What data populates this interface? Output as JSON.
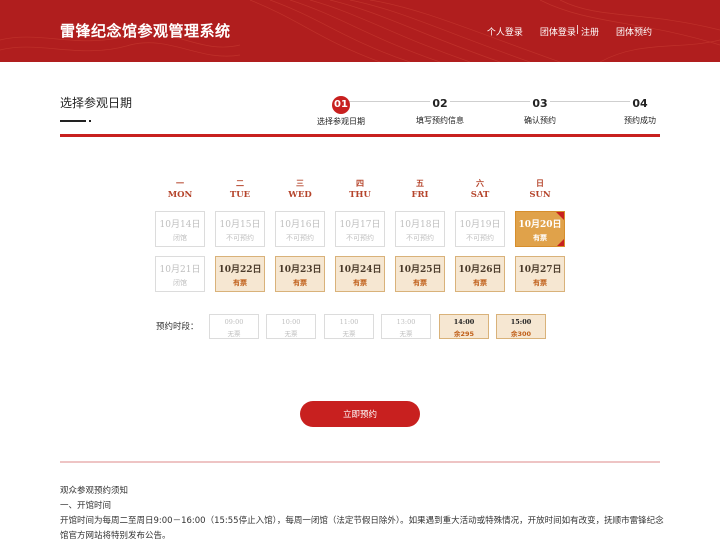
{
  "header": {
    "title": "雷锋纪念馆参观管理系统",
    "nav": {
      "personal_login": "个人登录",
      "group_login": "团体登录",
      "separator": "|",
      "register": "注册",
      "group_booking": "团体预约"
    },
    "bg_color": "#b01e1e"
  },
  "page": {
    "title": "选择参观日期"
  },
  "steps": [
    {
      "num": "01",
      "label": "选择参观日期",
      "active": true
    },
    {
      "num": "02",
      "label": "填写预约信息",
      "active": false
    },
    {
      "num": "03",
      "label": "确认预约",
      "active": false
    },
    {
      "num": "04",
      "label": "预约成功",
      "active": false
    }
  ],
  "weekdays": [
    {
      "cn": "一",
      "en": "MON"
    },
    {
      "cn": "二",
      "en": "TUE"
    },
    {
      "cn": "三",
      "en": "WED"
    },
    {
      "cn": "四",
      "en": "THU"
    },
    {
      "cn": "五",
      "en": "FRI"
    },
    {
      "cn": "六",
      "en": "SAT"
    },
    {
      "cn": "日",
      "en": "SUN"
    }
  ],
  "calendar": {
    "week1": [
      {
        "date": "10月14日",
        "status": "闭馆",
        "state": "closed"
      },
      {
        "date": "10月15日",
        "status": "不可预约",
        "state": "disabled"
      },
      {
        "date": "10月16日",
        "status": "不可预约",
        "state": "disabled"
      },
      {
        "date": "10月17日",
        "status": "不可预约",
        "state": "disabled"
      },
      {
        "date": "10月18日",
        "status": "不可预约",
        "state": "disabled"
      },
      {
        "date": "10月19日",
        "status": "不可预约",
        "state": "disabled"
      },
      {
        "date": "10月20日",
        "status": "有票",
        "state": "selected"
      }
    ],
    "week2": [
      {
        "date": "10月21日",
        "status": "闭馆",
        "state": "closed"
      },
      {
        "date": "10月22日",
        "status": "有票",
        "state": "available"
      },
      {
        "date": "10月23日",
        "status": "有票",
        "state": "available"
      },
      {
        "date": "10月24日",
        "status": "有票",
        "state": "available"
      },
      {
        "date": "10月25日",
        "status": "有票",
        "state": "available"
      },
      {
        "date": "10月26日",
        "status": "有票",
        "state": "available"
      },
      {
        "date": "10月27日",
        "status": "有票",
        "state": "available"
      }
    ]
  },
  "slots": {
    "label": "预约时段：",
    "items": [
      {
        "time": "09:00",
        "remaining": "无票",
        "available": false
      },
      {
        "time": "10:00",
        "remaining": "无票",
        "available": false
      },
      {
        "time": "11:00",
        "remaining": "无票",
        "available": false
      },
      {
        "time": "13:00",
        "remaining": "无票",
        "available": false
      },
      {
        "time": "14:00",
        "remaining": "余295",
        "available": true
      },
      {
        "time": "15:00",
        "remaining": "余300",
        "available": true
      }
    ]
  },
  "submit": {
    "label": "立即预约"
  },
  "notice": {
    "title": "观众参观预约须知",
    "section1_title": "一、开馆时间",
    "section1_text": "开馆时间为每周二至周日9:00－16:00（15:55停止入馆），每周一闭馆（法定节假日除外）。如果遇到重大活动或特殊情况，开放时间如有改变，抚顺市雷锋纪念馆官方网站将特别发布公告。"
  },
  "colors": {
    "accent_red": "#c8201f",
    "available_bg": "#f6e7d2",
    "selected_bg": "#e0a24a",
    "weekday_text": "#b5442b"
  }
}
